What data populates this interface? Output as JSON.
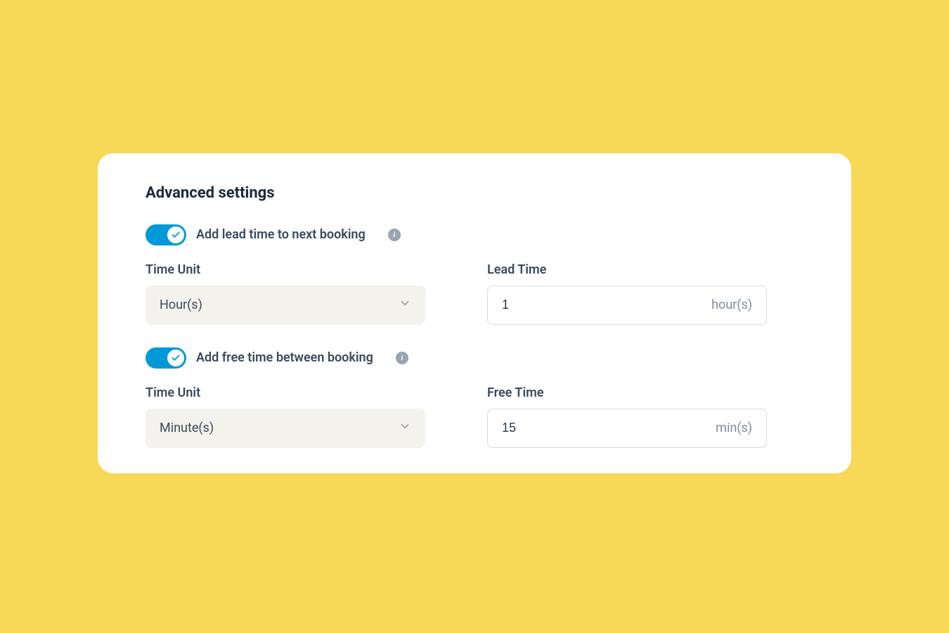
{
  "card": {
    "title": "Advanced settings",
    "lead_time_section": {
      "toggle_label": "Add lead time to next booking",
      "toggle_on": true,
      "time_unit_label": "Time Unit",
      "time_unit_value": "Hour(s)",
      "lead_time_label": "Lead Time",
      "lead_time_value": "1",
      "lead_time_suffix": "hour(s)"
    },
    "free_time_section": {
      "toggle_label": "Add free time between booking",
      "toggle_on": true,
      "time_unit_label": "Time Unit",
      "time_unit_value": "Minute(s)",
      "free_time_label": "Free Time",
      "free_time_value": "15",
      "free_time_suffix": "min(s)"
    }
  },
  "colors": {
    "page_bg": "#f8d857",
    "accent": "#0099d8",
    "text_dark": "#1d2b3a",
    "text_mid": "#3a4a5c",
    "text_muted": "#7f8c9b",
    "select_bg": "#f4f2ec",
    "border": "#d7dce1"
  }
}
